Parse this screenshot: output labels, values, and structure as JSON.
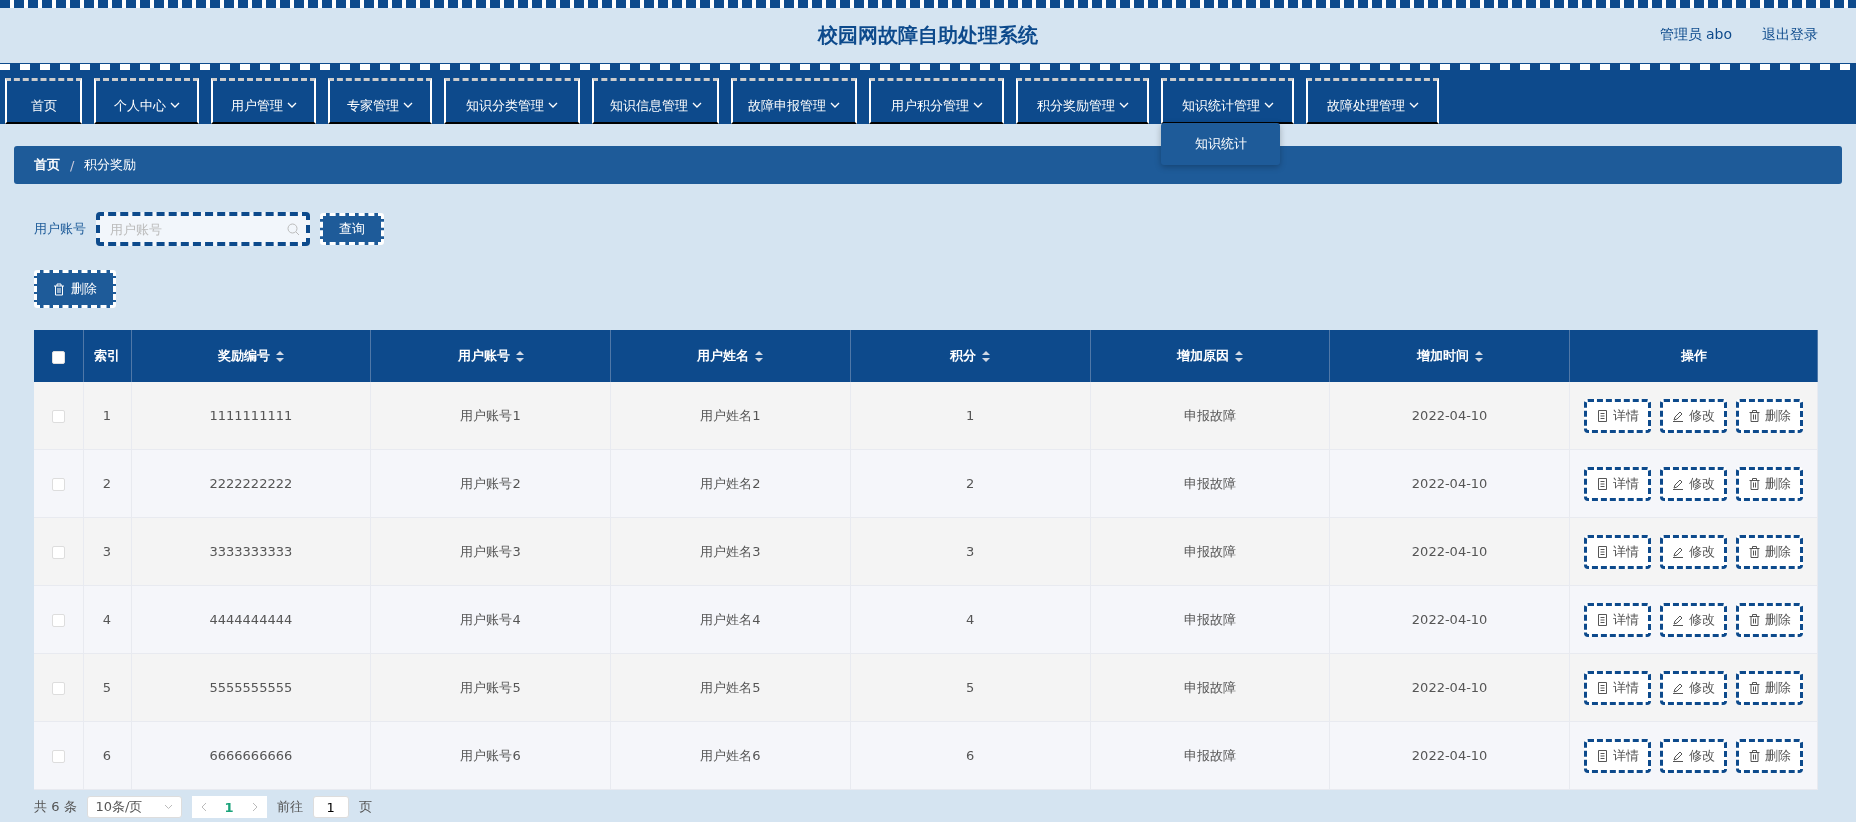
{
  "header": {
    "title": "校园网故障自助处理系统",
    "user": "管理员 abo",
    "logout": "退出登录"
  },
  "nav": [
    {
      "label": "首页",
      "kind": "link"
    },
    {
      "label": "个人中心",
      "kind": "dropdown"
    },
    {
      "label": "用户管理",
      "kind": "dropdown"
    },
    {
      "label": "专家管理",
      "kind": "dropdown"
    },
    {
      "label": "知识分类管理",
      "kind": "dropdown"
    },
    {
      "label": "知识信息管理",
      "kind": "dropdown"
    },
    {
      "label": "故障申报管理",
      "kind": "dropdown"
    },
    {
      "label": "用户积分管理",
      "kind": "dropdown"
    },
    {
      "label": "积分奖励管理",
      "kind": "dropdown"
    },
    {
      "label": "知识统计管理",
      "kind": "dropdown",
      "menu": [
        "知识统计"
      ]
    },
    {
      "label": "故障处理管理",
      "kind": "dropdown"
    }
  ],
  "breadcrumb": {
    "items": [
      "首页",
      "积分奖励"
    ],
    "separator": "/"
  },
  "search": {
    "label": "用户账号",
    "placeholder": "用户账号",
    "button": "查询"
  },
  "toolbar": {
    "delete_button": "删除"
  },
  "table": {
    "select_all": {
      "checked": false
    },
    "columns": [
      {
        "label": "索引",
        "sortable": false
      },
      {
        "label": "奖励编号",
        "sortable": true
      },
      {
        "label": "用户账号",
        "sortable": true
      },
      {
        "label": "用户姓名",
        "sortable": true
      },
      {
        "label": "积分",
        "sortable": true
      },
      {
        "label": "增加原因",
        "sortable": true
      },
      {
        "label": "增加时间",
        "sortable": true
      },
      {
        "label": "操作",
        "sortable": false
      }
    ],
    "rows": [
      {
        "checked": false,
        "cells": [
          "1",
          "1111111111",
          "用户账号1",
          "用户姓名1",
          "1",
          "申报故障",
          "2022-04-10"
        ],
        "actions": [
          {
            "kind": "detail",
            "label": "详情"
          },
          {
            "kind": "edit",
            "label": "修改"
          },
          {
            "kind": "delete",
            "label": "删除"
          }
        ]
      },
      {
        "checked": false,
        "cells": [
          "2",
          "2222222222",
          "用户账号2",
          "用户姓名2",
          "2",
          "申报故障",
          "2022-04-10"
        ],
        "actions": [
          {
            "kind": "detail",
            "label": "详情"
          },
          {
            "kind": "edit",
            "label": "修改"
          },
          {
            "kind": "delete",
            "label": "删除"
          }
        ]
      },
      {
        "checked": false,
        "cells": [
          "3",
          "3333333333",
          "用户账号3",
          "用户姓名3",
          "3",
          "申报故障",
          "2022-04-10"
        ],
        "actions": [
          {
            "kind": "detail",
            "label": "详情"
          },
          {
            "kind": "edit",
            "label": "修改"
          },
          {
            "kind": "delete",
            "label": "删除"
          }
        ]
      },
      {
        "checked": false,
        "cells": [
          "4",
          "4444444444",
          "用户账号4",
          "用户姓名4",
          "4",
          "申报故障",
          "2022-04-10"
        ],
        "actions": [
          {
            "kind": "detail",
            "label": "详情"
          },
          {
            "kind": "edit",
            "label": "修改"
          },
          {
            "kind": "delete",
            "label": "删除"
          }
        ]
      },
      {
        "checked": false,
        "cells": [
          "5",
          "5555555555",
          "用户账号5",
          "用户姓名5",
          "5",
          "申报故障",
          "2022-04-10"
        ],
        "actions": [
          {
            "kind": "detail",
            "label": "详情"
          },
          {
            "kind": "edit",
            "label": "修改"
          },
          {
            "kind": "delete",
            "label": "删除"
          }
        ]
      },
      {
        "checked": false,
        "cells": [
          "6",
          "6666666666",
          "用户账号6",
          "用户姓名6",
          "6",
          "申报故障",
          "2022-04-10"
        ],
        "actions": [
          {
            "kind": "detail",
            "label": "详情"
          },
          {
            "kind": "edit",
            "label": "修改"
          },
          {
            "kind": "delete",
            "label": "删除"
          }
        ]
      }
    ]
  },
  "pagination": {
    "total": "共 6 条",
    "page_size": "10条/页",
    "pages": [
      {
        "label": "1",
        "selected": true
      }
    ],
    "goto_label": "前往",
    "goto_value": "1",
    "goto_suffix": "页"
  }
}
